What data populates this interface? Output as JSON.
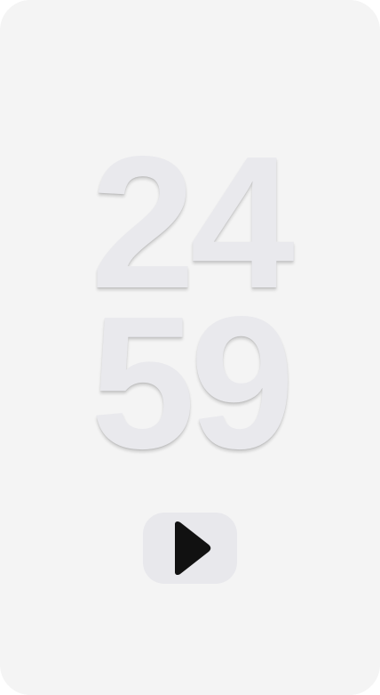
{
  "timer": {
    "hours": "24",
    "minutes": "59"
  },
  "controls": {
    "play_icon": "play-icon"
  },
  "colors": {
    "background": "#f4f4f4",
    "digit_color": "#e9e9ed",
    "button_background": "#e8e8ec",
    "icon_color": "#111111"
  }
}
